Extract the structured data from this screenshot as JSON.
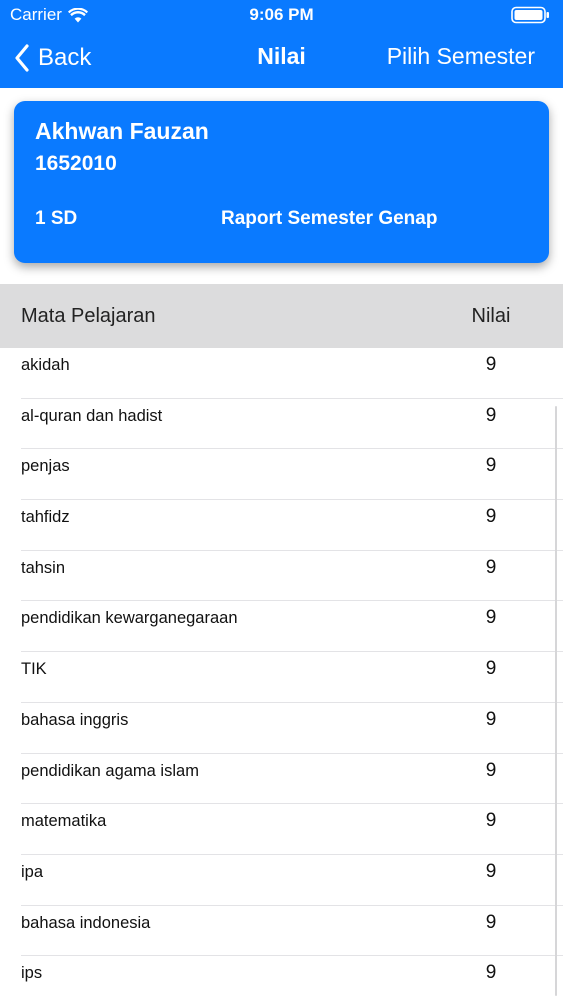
{
  "status_bar": {
    "carrier": "Carrier",
    "time": "9:06 PM",
    "icons": [
      "wifi-icon",
      "battery-icon"
    ]
  },
  "nav": {
    "back_label": "Back",
    "title": "Nilai",
    "action_label": "Pilih Semester",
    "icons": [
      "chevron-left-icon"
    ]
  },
  "student": {
    "name": "Akhwan Fauzan",
    "id": "1652010",
    "class": "1 SD",
    "report": "Raport Semester Genap"
  },
  "table": {
    "headers": {
      "subject": "Mata Pelajaran",
      "score": "Nilai"
    },
    "rows": [
      {
        "subject": "akidah",
        "score": "9"
      },
      {
        "subject": "al-quran dan hadist",
        "score": "9"
      },
      {
        "subject": "penjas",
        "score": "9"
      },
      {
        "subject": "tahfidz",
        "score": "9"
      },
      {
        "subject": "tahsin",
        "score": "9"
      },
      {
        "subject": "pendidikan kewarganegaraan",
        "score": "9"
      },
      {
        "subject": "TIK",
        "score": "9"
      },
      {
        "subject": "bahasa inggris",
        "score": "9"
      },
      {
        "subject": "pendidikan agama islam",
        "score": "9"
      },
      {
        "subject": "matematika",
        "score": "9"
      },
      {
        "subject": "ipa",
        "score": "9"
      },
      {
        "subject": "bahasa indonesia",
        "score": "9"
      },
      {
        "subject": "ips",
        "score": "9"
      }
    ]
  },
  "colors": {
    "accent": "#0A7AFF",
    "header_bg": "#DCDCDD",
    "separator": "#E3E3E6"
  }
}
